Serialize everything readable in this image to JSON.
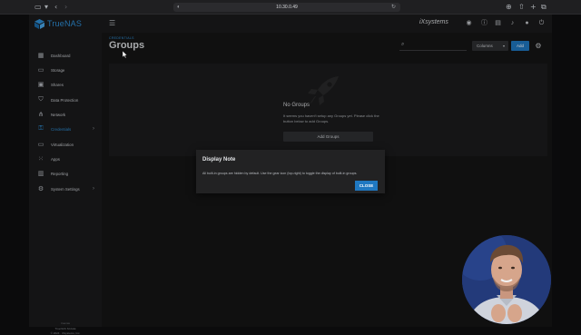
{
  "browser": {
    "address": "10.30.0.49"
  },
  "app": {
    "brand": "TrueNAS",
    "partner_logo": "iXsystems",
    "colors": {
      "accent": "#2e8fd7",
      "primary_button": "#1f78c1",
      "background": "#151515",
      "panel": "#1c1c1d"
    }
  },
  "topbar": {
    "icons": [
      "hamburger-icon",
      "truecommand-icon",
      "info-icon",
      "clipboard-icon",
      "bell-icon",
      "account-icon",
      "power-icon"
    ]
  },
  "sidebar": {
    "items": [
      {
        "label": "Dashboard",
        "icon": "dashboard-icon"
      },
      {
        "label": "Storage",
        "icon": "storage-icon"
      },
      {
        "label": "Shares",
        "icon": "shares-icon"
      },
      {
        "label": "Data Protection",
        "icon": "shield-icon"
      },
      {
        "label": "Network",
        "icon": "network-icon"
      },
      {
        "label": "Credentials",
        "icon": "key-icon",
        "active": true,
        "has_children": true
      },
      {
        "label": "Virtualization",
        "icon": "monitor-icon"
      },
      {
        "label": "Apps",
        "icon": "apps-icon"
      },
      {
        "label": "Reporting",
        "icon": "chart-icon"
      },
      {
        "label": "System Settings",
        "icon": "gear-icon",
        "has_children": true
      }
    ],
    "footer": {
      "line1": "truenas",
      "line2": "TrueNAS SCALE",
      "line3": "© 2024 · iXsystems, Inc."
    }
  },
  "page": {
    "breadcrumb": "CREDENTIALS",
    "title": "Groups",
    "search_placeholder": "",
    "columns_label": "Columns",
    "add_label": "Add"
  },
  "empty_state": {
    "title": "No Groups",
    "description": "It seems you haven't setup any Groups yet. Please click the button below to add Groups.",
    "button_label": "Add Groups"
  },
  "dialog": {
    "title": "Display Note",
    "message": "All built-in groups are hidden by default. Use the gear icon (top-right) to toggle the display of built-in groups.",
    "close_label": "CLOSE"
  }
}
